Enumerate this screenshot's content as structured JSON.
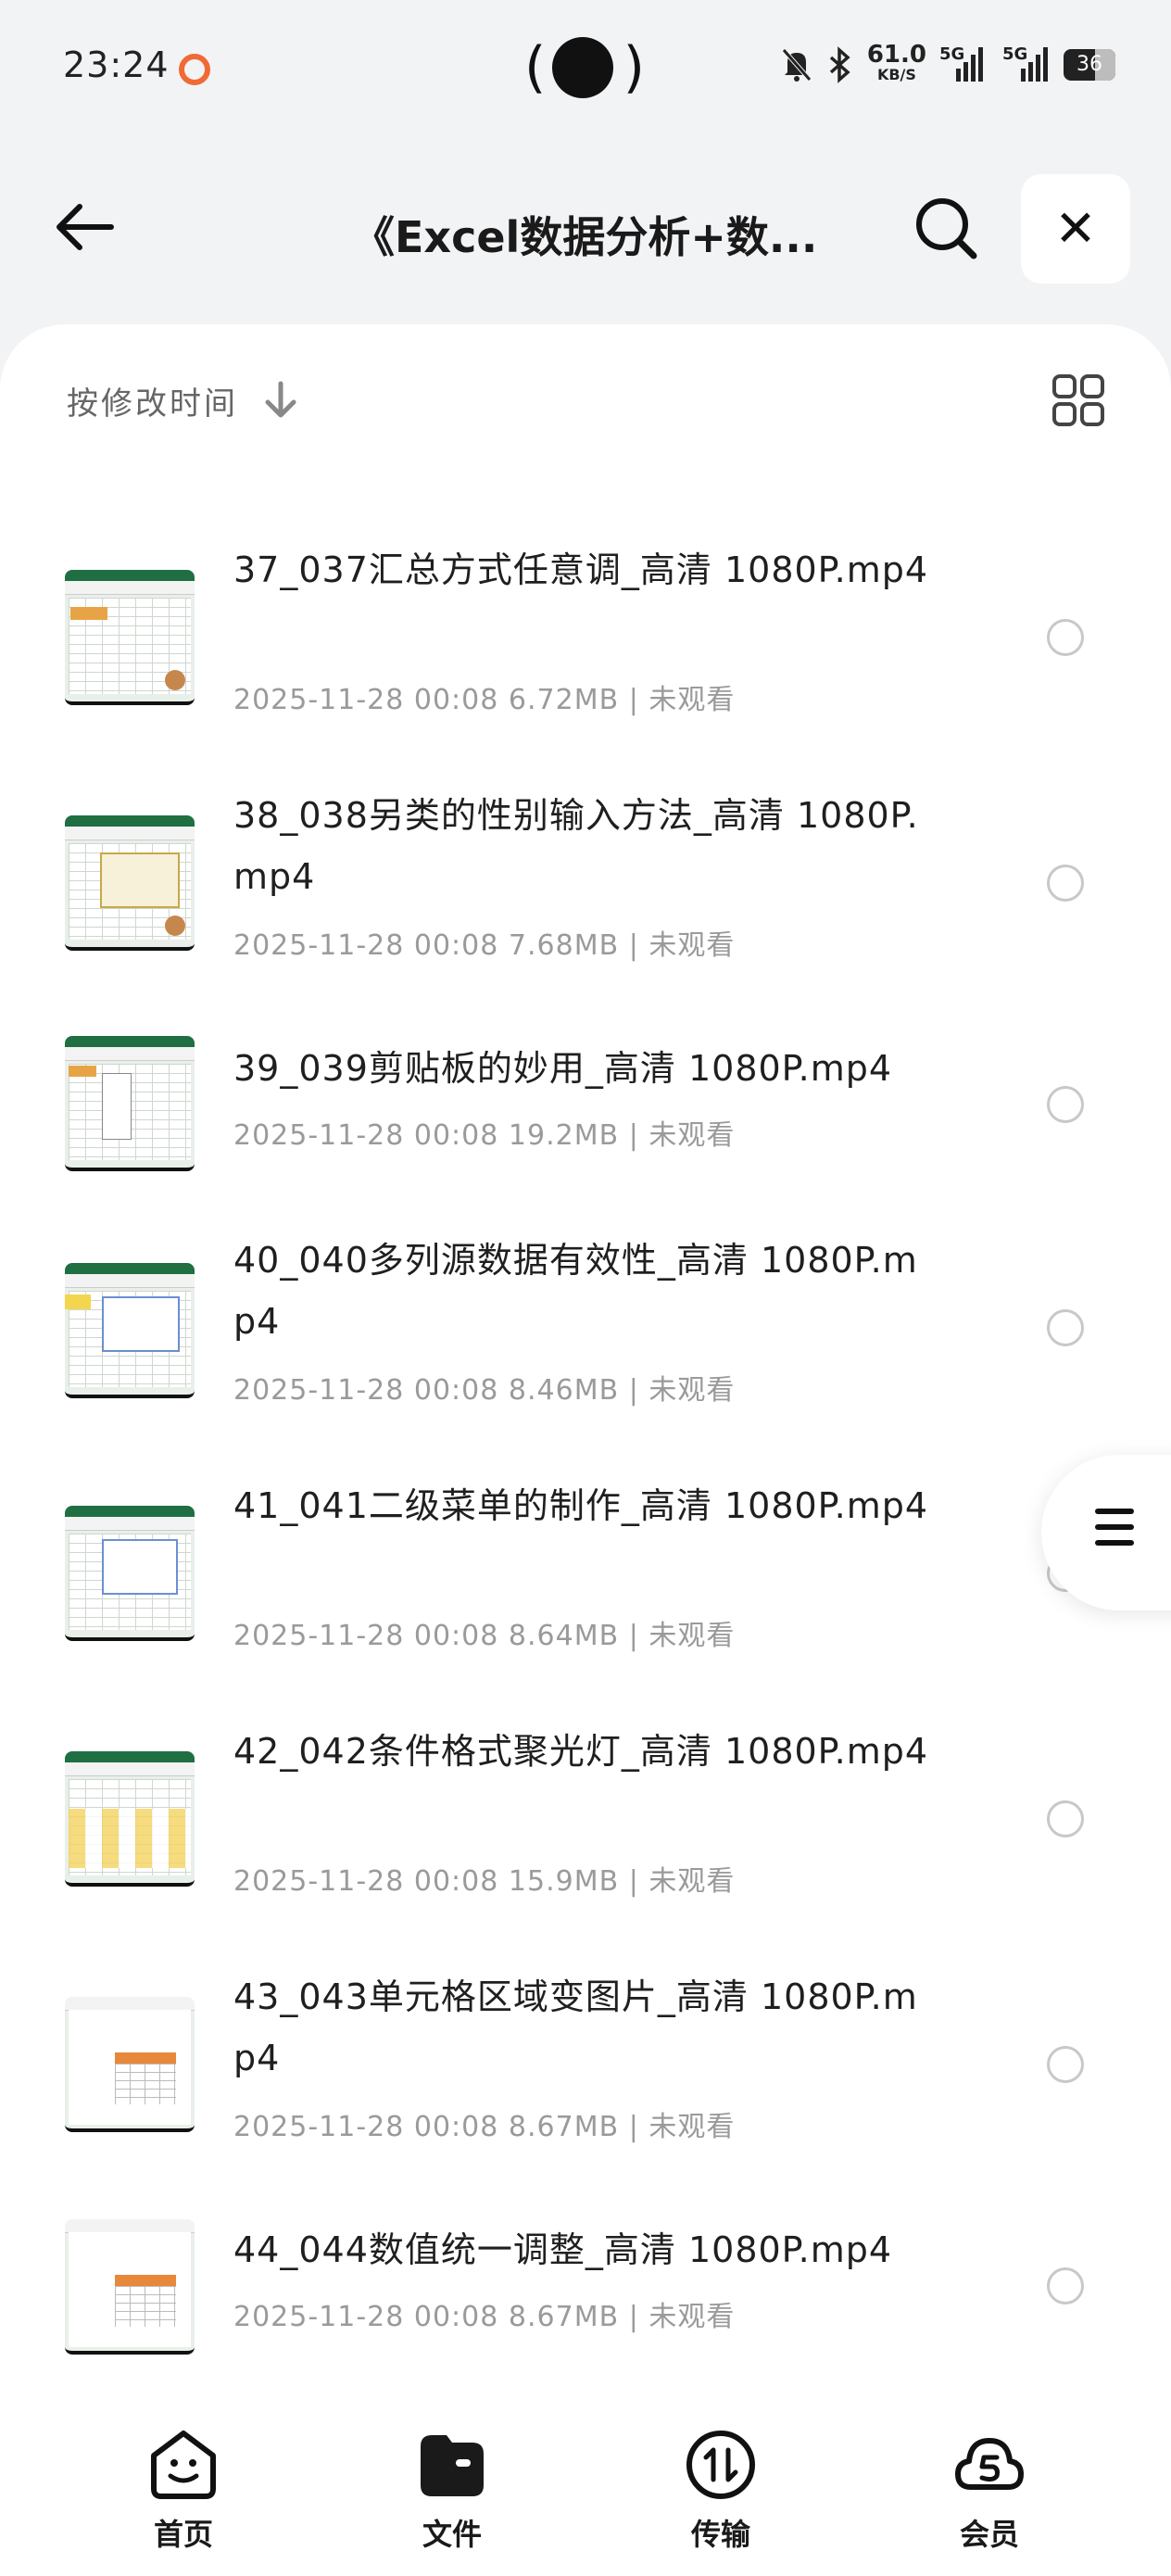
{
  "status_bar": {
    "time": "23:24",
    "net_speed": "61.0",
    "net_unit": "KB/S",
    "signal1": "5G",
    "signal2": "5G",
    "battery": "36"
  },
  "header": {
    "title": "《Excel数据分析+数..."
  },
  "sort": {
    "label": "按修改时间"
  },
  "files": [
    {
      "name": "37_037汇总方式任意调_高清 1080P.mp4",
      "date": "2025-11-28 00:08",
      "size": "6.72MB",
      "status": "未观看"
    },
    {
      "name": "38_038另类的性别输入方法_高清 1080P.mp4",
      "date": "2025-11-28 00:08",
      "size": "7.68MB",
      "status": "未观看"
    },
    {
      "name": "39_039剪贴板的妙用_高清 1080P.mp4",
      "date": "2025-11-28 00:08",
      "size": "19.2MB",
      "status": "未观看"
    },
    {
      "name": "40_040多列源数据有效性_高清 1080P.mp4",
      "date": "2025-11-28 00:08",
      "size": "8.46MB",
      "status": "未观看"
    },
    {
      "name": "41_041二级菜单的制作_高清 1080P.mp4",
      "date": "2025-11-28 00:08",
      "size": "8.64MB",
      "status": "未观看"
    },
    {
      "name": "42_042条件格式聚光灯_高清 1080P.mp4",
      "date": "2025-11-28 00:08",
      "size": "15.9MB",
      "status": "未观看"
    },
    {
      "name": "43_043单元格区域变图片_高清 1080P.mp4",
      "date": "2025-11-28 00:08",
      "size": "8.67MB",
      "status": "未观看"
    },
    {
      "name": "44_044数值统一调整_高清 1080P.mp4",
      "date": "2025-11-28 00:08",
      "size": "8.67MB",
      "status": "未观看"
    }
  ],
  "bottom_nav": [
    {
      "label": "首页",
      "icon": "home-face-icon"
    },
    {
      "label": "文件",
      "icon": "folder-icon"
    },
    {
      "label": "传输",
      "icon": "transfer-icon"
    },
    {
      "label": "会员",
      "icon": "vip-cloud-icon"
    }
  ]
}
